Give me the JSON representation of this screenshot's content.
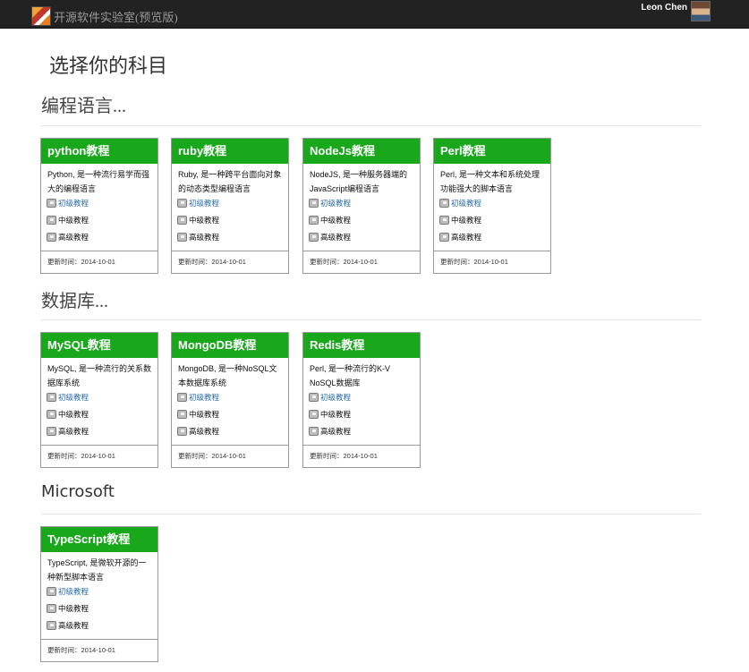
{
  "topbar": {
    "brand": "开源软件实验室(预览版)",
    "user_name": "Leon Chen"
  },
  "page_title": "选择你的科目",
  "sections": [
    {
      "title": "编程语言...",
      "cards": [
        {
          "title": "python教程",
          "desc": "Python, 是一种流行易学而强大的编程语言",
          "levels": [
            "初级教程",
            "中级教程",
            "高级教程"
          ],
          "updated": "更新时间：2014-10-01"
        },
        {
          "title": "ruby教程",
          "desc": "Ruby, 是一种跨平台面向对象的动态类型编程语言",
          "levels": [
            "初级教程",
            "中级教程",
            "高级教程"
          ],
          "updated": "更新时间：2014-10-01"
        },
        {
          "title": "NodeJs教程",
          "desc": "NodeJS, 是一种服务器端的JavaScript编程语言",
          "levels": [
            "初级教程",
            "中级教程",
            "高级教程"
          ],
          "updated": "更新时间：2014-10-01"
        },
        {
          "title": "Perl教程",
          "desc": "Perl, 是一种文本和系统处理功能强大的脚本语言",
          "levels": [
            "初级教程",
            "中级教程",
            "高级教程"
          ],
          "updated": "更新时间：2014-10-01"
        }
      ]
    },
    {
      "title": "数据库...",
      "cards": [
        {
          "title": "MySQL教程",
          "desc": "MySQL, 是一种流行的关系数据库系统",
          "levels": [
            "初级教程",
            "中级教程",
            "高级教程"
          ],
          "updated": "更新时间：2014-10-01"
        },
        {
          "title": "MongoDB教程",
          "desc": "MongoDB, 是一种NoSQL文本数据库系统",
          "levels": [
            "初级教程",
            "中级教程",
            "高级教程"
          ],
          "updated": "更新时间：2014-10-01"
        },
        {
          "title": "Redis教程",
          "desc": "Perl, 是一种流行的K-V NoSQL数据库",
          "levels": [
            "初级教程",
            "中级教程",
            "高级教程"
          ],
          "updated": "更新时间：2014-10-01"
        }
      ]
    },
    {
      "title": "Microsoft",
      "cards": [
        {
          "title": "TypeScript教程",
          "desc": "TypeScript, 是微软开源的一种新型脚本语言",
          "levels": [
            "初级教程",
            "中级教程",
            "高级教程"
          ],
          "updated": "更新时间：2014-10-01"
        }
      ]
    }
  ],
  "icons": {
    "logo": "lab-logo-icon",
    "level": "book-icon"
  },
  "colors": {
    "topbar": "#222222",
    "card_header": "#19a81c",
    "link": "#2a6db5"
  }
}
